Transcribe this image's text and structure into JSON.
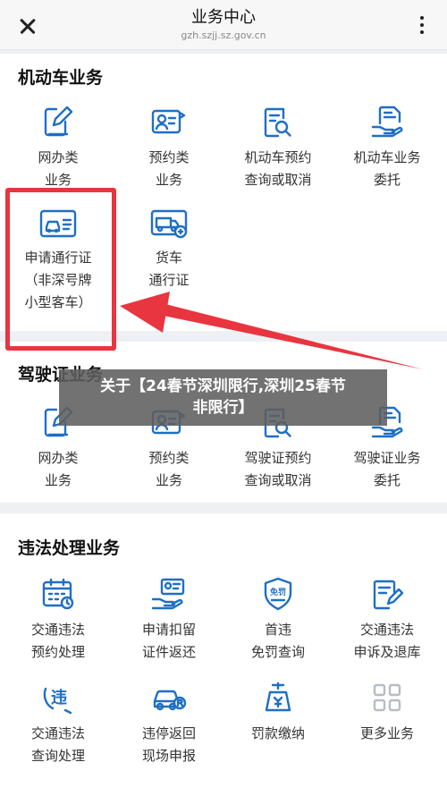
{
  "header": {
    "title": "业务中心",
    "url": "gzh.szjj.sz.gov.cn"
  },
  "sections": [
    {
      "title": "机动车业务",
      "items": [
        {
          "line1": "网办类",
          "line2": "业务",
          "icon": "edit-doc-icon"
        },
        {
          "line1": "预约类",
          "line2": "业务",
          "icon": "id-card-icon"
        },
        {
          "line1": "机动车预约",
          "line2": "查询或取消",
          "icon": "search-doc-icon"
        },
        {
          "line1": "机动车业务",
          "line2": "委托",
          "icon": "hand-doc-icon"
        },
        {
          "line1": "申请通行证",
          "line2": "（非深号牌",
          "line3": "小型客车）",
          "icon": "car-pass-icon"
        },
        {
          "line1": "货车",
          "line2": "通行证",
          "icon": "truck-pass-icon"
        }
      ]
    },
    {
      "title": "驾驶证业务",
      "items": [
        {
          "line1": "网办类",
          "line2": "业务",
          "icon": "edit-doc-icon"
        },
        {
          "line1": "预约类",
          "line2": "业务",
          "icon": "id-card-icon"
        },
        {
          "line1": "驾驶证预约",
          "line2": "查询或取消",
          "icon": "search-doc-icon"
        },
        {
          "line1": "驾驶证业务",
          "line2": "委托",
          "icon": "hand-doc-icon"
        }
      ]
    },
    {
      "title": "违法处理业务",
      "items": [
        {
          "line1": "交通违法",
          "line2": "预约处理",
          "icon": "calendar-icon"
        },
        {
          "line1": "申请扣留",
          "line2": "证件返还",
          "icon": "hand-card-icon"
        },
        {
          "line1": "首违",
          "line2": "免罚查询",
          "icon": "waiver-badge-icon",
          "badge": "免罚"
        },
        {
          "line1": "交通违法",
          "line2": "申诉及退库",
          "icon": "appeal-doc-icon"
        },
        {
          "line1": "交通违法",
          "line2": "查询处理",
          "icon": "violation-icon",
          "badge": "违"
        },
        {
          "line1": "违停返回",
          "line2": "现场申报",
          "icon": "tow-car-icon"
        },
        {
          "line1": "罚款缴纳",
          "line2": "",
          "icon": "fine-payment-icon"
        },
        {
          "line1": "更多业务",
          "line2": "",
          "icon": "grid-more-icon"
        }
      ]
    }
  ],
  "overlay": {
    "line1": "关于【24春节深圳限行,深圳25春节",
    "line2": "非限行】"
  },
  "colors": {
    "icon_blue": "#1f6fc5",
    "annotation_red": "#e8353f",
    "more_gray": "#b7bcc4"
  }
}
